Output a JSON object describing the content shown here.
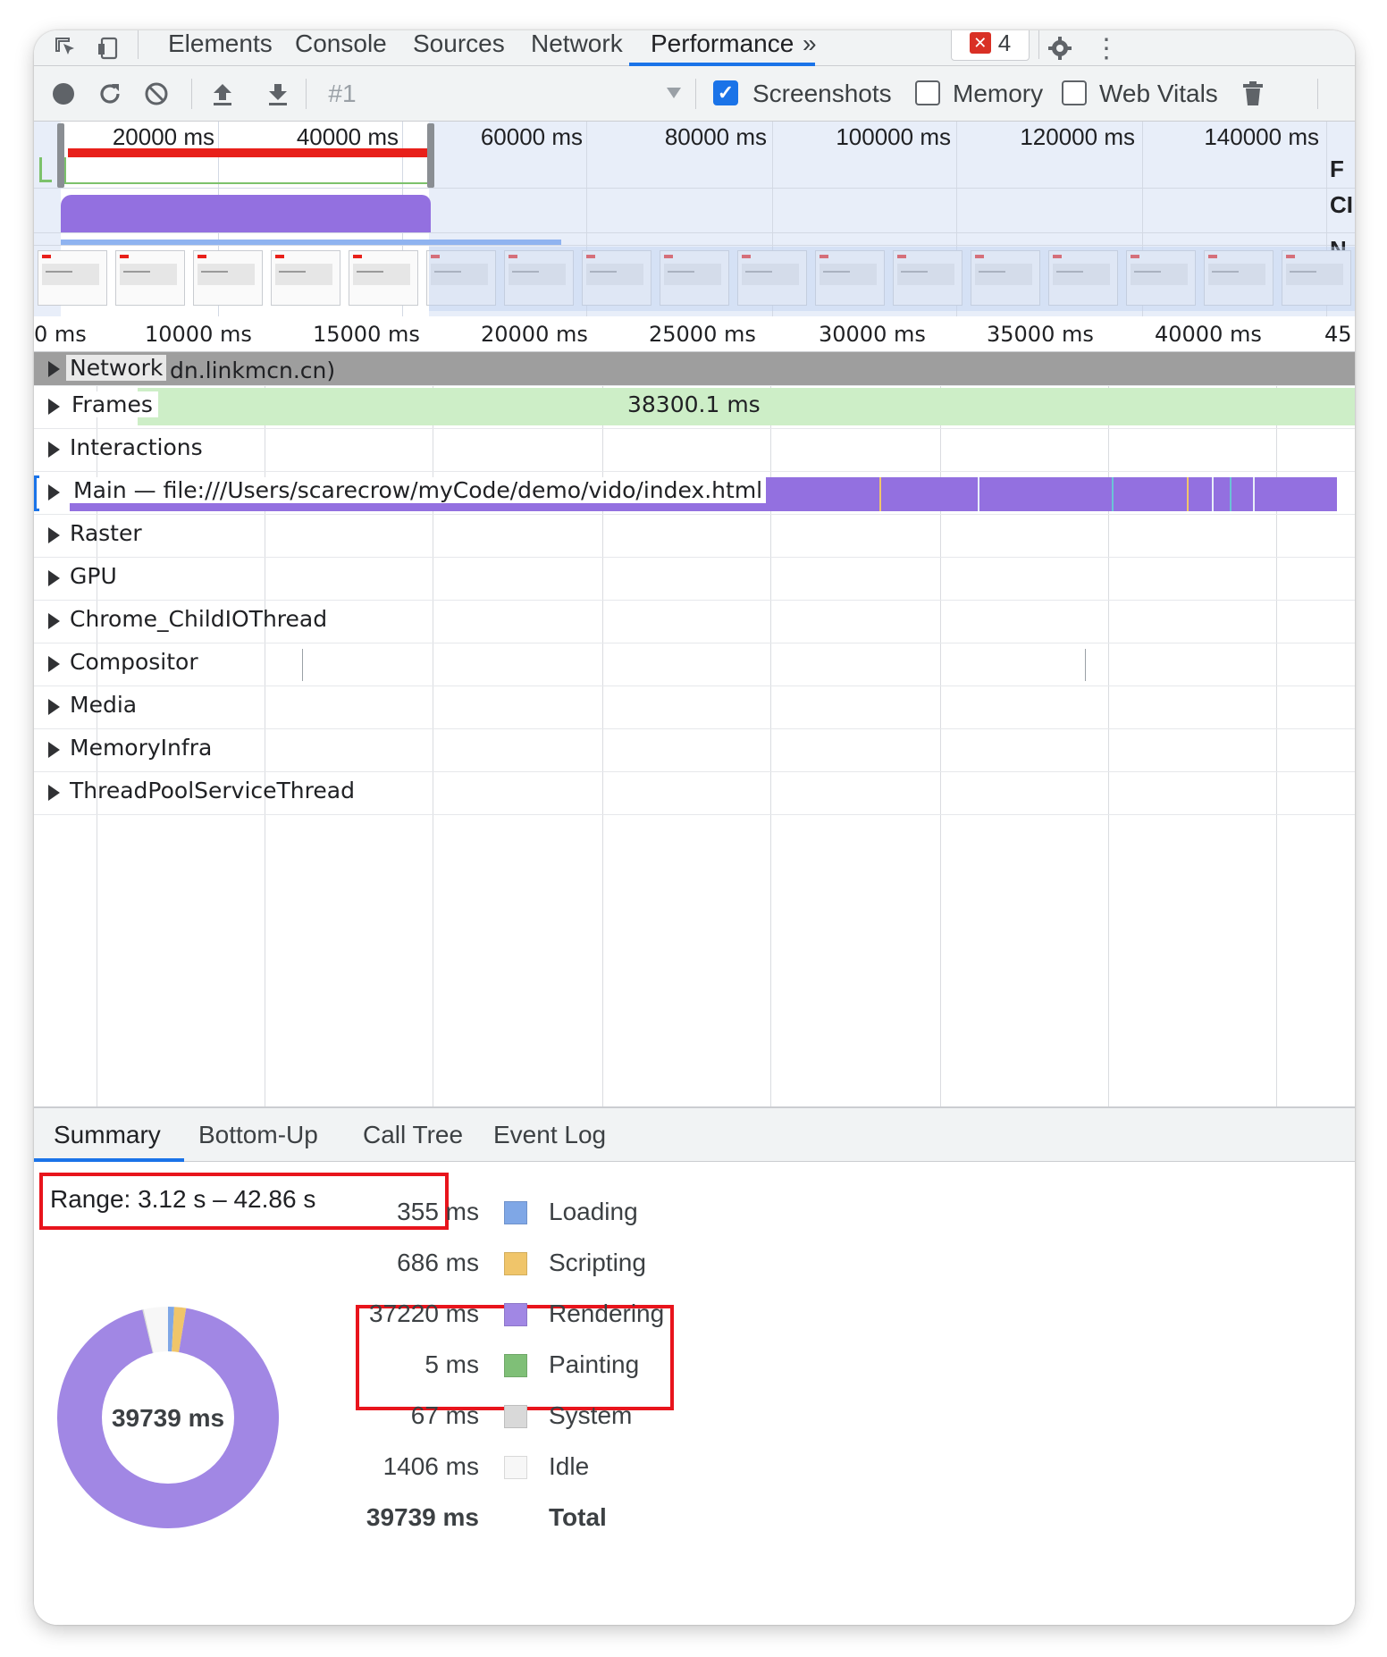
{
  "tabs": {
    "items": [
      "Elements",
      "Console",
      "Sources",
      "Network",
      "Performance"
    ],
    "more": "»",
    "error_count": "4"
  },
  "toolbar": {
    "recording": "#1",
    "screenshots_label": "Screenshots",
    "screenshots_checked": true,
    "memory_label": "Memory",
    "memory_checked": false,
    "webvitals_label": "Web Vitals",
    "webvitals_checked": false
  },
  "overview": {
    "ticks": [
      "20000 ms",
      "40000 ms",
      "60000 ms",
      "80000 ms",
      "100000 ms",
      "120000 ms",
      "140000 ms"
    ],
    "side_labels": [
      "F",
      "CI",
      "N"
    ]
  },
  "ruler": {
    "ticks": [
      "0 ms",
      "10000 ms",
      "15000 ms",
      "20000 ms",
      "25000 ms",
      "30000 ms",
      "35000 ms",
      "40000 ms",
      "45"
    ]
  },
  "tracks": {
    "network": {
      "label": "Network",
      "host": "dn.linkmcn.cn)"
    },
    "frames": {
      "label": "Frames",
      "duration": "38300.1 ms"
    },
    "interactions": "Interactions",
    "main": "Main — file:///Users/scarecrow/myCode/demo/vido/index.html",
    "raster": "Raster",
    "gpu": "GPU",
    "childio": "Chrome_ChildIOThread",
    "compositor": "Compositor",
    "media": "Media",
    "memoryinfra": "MemoryInfra",
    "threadpool": "ThreadPoolServiceThread"
  },
  "bottom_tabs": [
    "Summary",
    "Bottom-Up",
    "Call Tree",
    "Event Log"
  ],
  "summary": {
    "range": "Range: 3.12 s – 42.86 s",
    "total_center": "39739 ms",
    "rows": [
      {
        "value": "355 ms",
        "label": "Loading",
        "color": "#7fa7e6"
      },
      {
        "value": "686 ms",
        "label": "Scripting",
        "color": "#f0c56a"
      },
      {
        "value": "37220 ms",
        "label": "Rendering",
        "color": "#a187e4"
      },
      {
        "value": "5 ms",
        "label": "Painting",
        "color": "#7fbf77"
      },
      {
        "value": "67 ms",
        "label": "System",
        "color": "#d9d9d9"
      },
      {
        "value": "1406 ms",
        "label": "Idle",
        "color": "#f7f7f7"
      }
    ],
    "total": {
      "value": "39739 ms",
      "label": "Total"
    }
  }
}
